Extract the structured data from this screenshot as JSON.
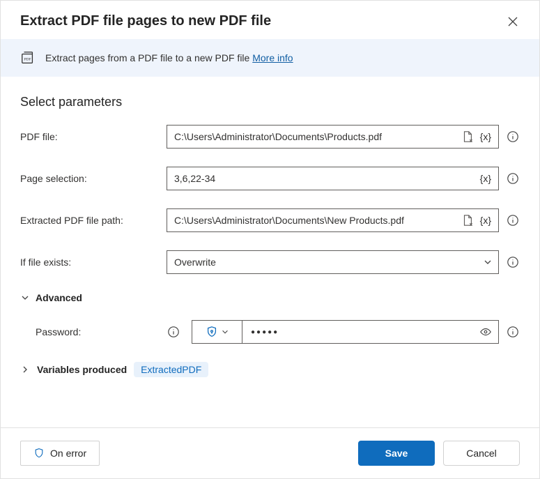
{
  "header": {
    "title": "Extract PDF file pages to new PDF file"
  },
  "banner": {
    "text": "Extract pages from a PDF file to a new PDF file ",
    "link": "More info"
  },
  "section_title": "Select parameters",
  "fields": {
    "pdf_file": {
      "label": "PDF file:",
      "value": "C:\\Users\\Administrator\\Documents\\Products.pdf"
    },
    "page_selection": {
      "label": "Page selection:",
      "value": "3,6,22-34"
    },
    "extracted_path": {
      "label": "Extracted PDF file path:",
      "value": "C:\\Users\\Administrator\\Documents\\New Products.pdf"
    },
    "if_exists": {
      "label": "If file exists:",
      "value": "Overwrite"
    },
    "password": {
      "label": "Password:",
      "value": "●●●●●"
    }
  },
  "advanced_label": "Advanced",
  "variables": {
    "label": "Variables produced",
    "badge": "ExtractedPDF"
  },
  "footer": {
    "on_error": "On error",
    "save": "Save",
    "cancel": "Cancel"
  },
  "tokens": {
    "var": "{x}"
  }
}
